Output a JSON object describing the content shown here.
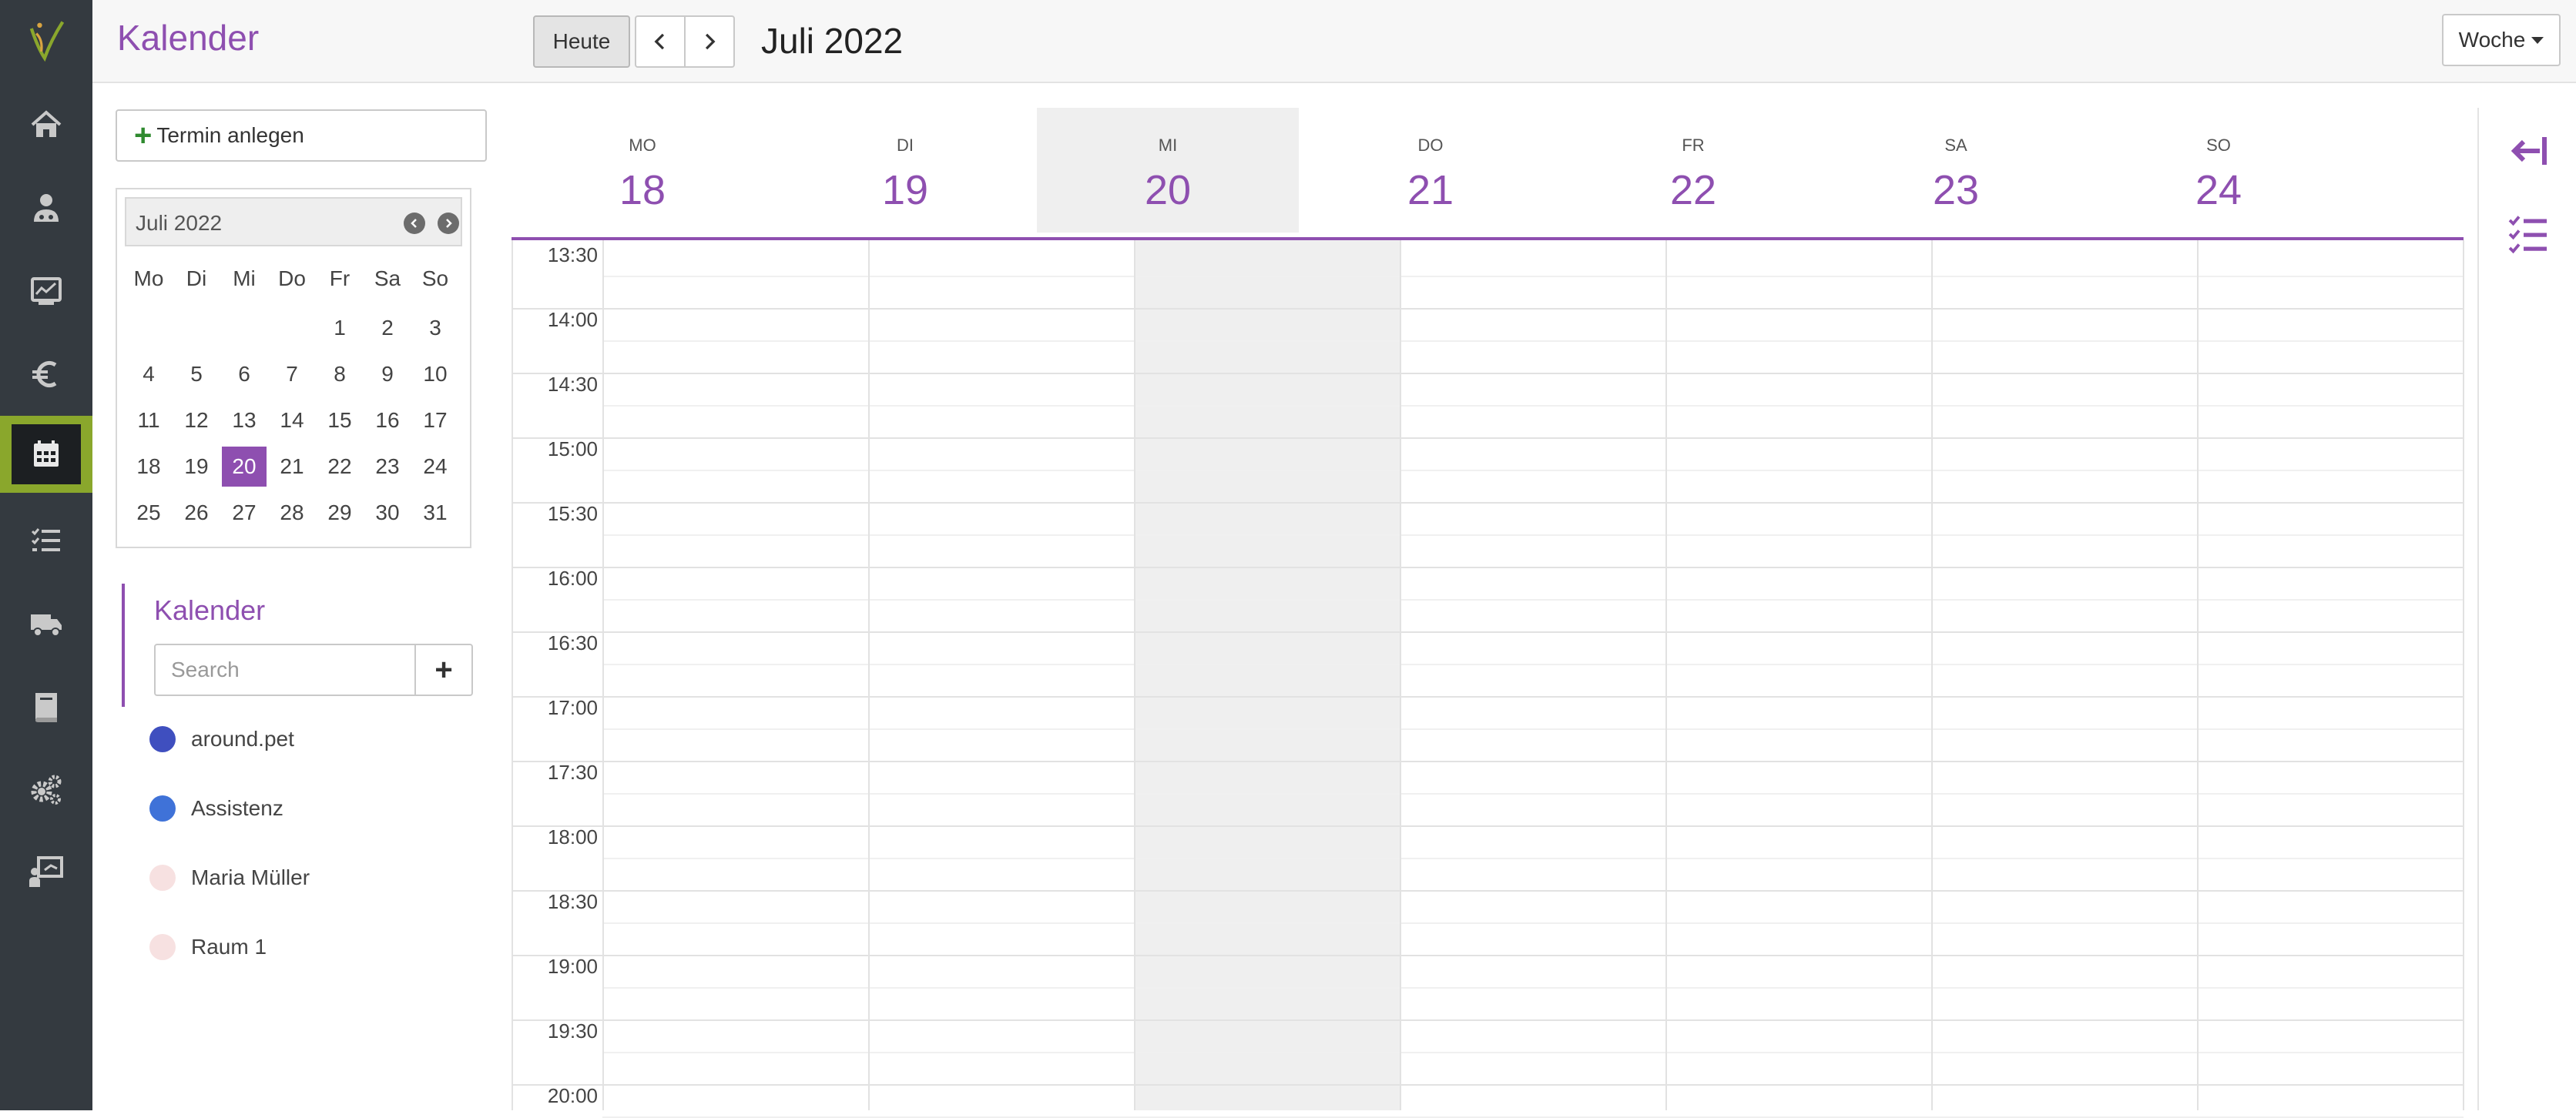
{
  "app": {
    "title": "Kalender"
  },
  "rail": {
    "items": [
      {
        "icon": "home-icon"
      },
      {
        "icon": "patient-icon"
      },
      {
        "icon": "monitor-chart-icon"
      },
      {
        "icon": "euro-icon"
      },
      {
        "icon": "calendar-icon",
        "active": true
      },
      {
        "icon": "task-list-icon"
      },
      {
        "icon": "truck-icon"
      },
      {
        "icon": "book-icon"
      },
      {
        "icon": "gears-icon"
      },
      {
        "icon": "presentation-icon"
      }
    ],
    "active_color": "#8aa72c"
  },
  "toolbar": {
    "today_label": "Heute",
    "period_title": "Juli 2022",
    "view_label": "Woche"
  },
  "sidebar": {
    "new_event_label": "Termin anlegen",
    "mini_calendar": {
      "title": "Juli 2022",
      "weekdays": [
        "Mo",
        "Di",
        "Mi",
        "Do",
        "Fr",
        "Sa",
        "So"
      ],
      "weeks": [
        [
          "",
          "",
          "",
          "",
          "1",
          "2",
          "3"
        ],
        [
          "4",
          "5",
          "6",
          "7",
          "8",
          "9",
          "10"
        ],
        [
          "11",
          "12",
          "13",
          "14",
          "15",
          "16",
          "17"
        ],
        [
          "18",
          "19",
          "20",
          "21",
          "22",
          "23",
          "24"
        ],
        [
          "25",
          "26",
          "27",
          "28",
          "29",
          "30",
          "31"
        ]
      ],
      "selected": "20"
    },
    "calendars_title": "Kalender",
    "search_placeholder": "Search",
    "calendars": [
      {
        "name": "around.pet",
        "color": "#3f4fbf"
      },
      {
        "name": "Assistenz",
        "color": "#3f72d8"
      },
      {
        "name": "Maria Müller",
        "color": "#f7e1e1"
      },
      {
        "name": "Raum 1",
        "color": "#f7e1e1"
      }
    ]
  },
  "week": {
    "accent": "#8e4fb0",
    "days": [
      {
        "dow": "MO",
        "num": "18"
      },
      {
        "dow": "DI",
        "num": "19"
      },
      {
        "dow": "MI",
        "num": "20",
        "today": true
      },
      {
        "dow": "DO",
        "num": "21"
      },
      {
        "dow": "FR",
        "num": "22"
      },
      {
        "dow": "SA",
        "num": "23"
      },
      {
        "dow": "SO",
        "num": "24"
      }
    ],
    "times": [
      "13:30",
      "14:00",
      "14:30",
      "15:00",
      "15:30",
      "16:00",
      "16:30",
      "17:00",
      "17:30",
      "18:00",
      "18:30",
      "19:00",
      "19:30",
      "20:00"
    ]
  },
  "right_rail": {
    "items": [
      {
        "icon": "collapse-left-icon"
      },
      {
        "icon": "checklist-icon"
      }
    ]
  }
}
